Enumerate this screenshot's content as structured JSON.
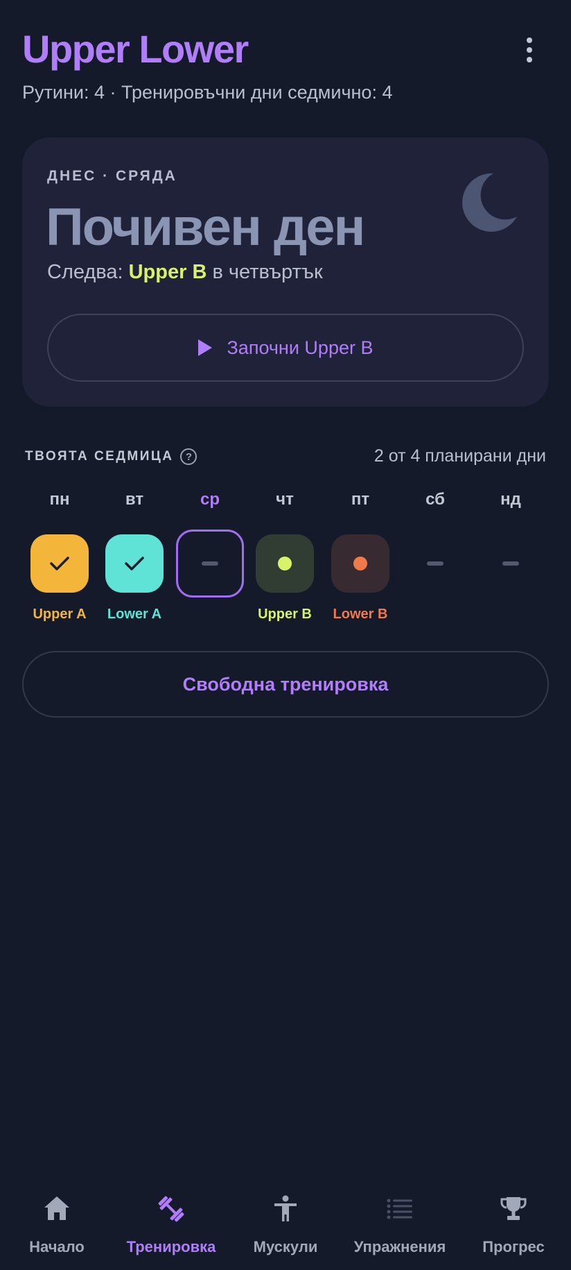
{
  "header": {
    "title": "Upper Lower",
    "subtitle": "Рутини: 4 · Тренировъчни дни седмично: 4",
    "menu_icon": "more-vertical-icon"
  },
  "today": {
    "label": "ДНЕС · СРЯДА",
    "title": "Почивен ден",
    "next_prefix": "Следва: ",
    "next_routine": "Upper B",
    "next_suffix": " в четвъртък",
    "start_button": "Започни Upper B",
    "icon": "moon-icon"
  },
  "week": {
    "label": "ТВОЯТА СЕДМИЦА",
    "help_glyph": "?",
    "summary": "2 от 4 планирани дни",
    "days": [
      {
        "name": "пн",
        "routine": "Upper A",
        "state": "done",
        "color": "#f3b63a"
      },
      {
        "name": "вт",
        "routine": "Lower A",
        "state": "done",
        "color": "#5ee3d6"
      },
      {
        "name": "ср",
        "routine": "",
        "state": "today",
        "color": "#a06ef0"
      },
      {
        "name": "чт",
        "routine": "Upper B",
        "state": "planned",
        "color": "#d8f26a"
      },
      {
        "name": "пт",
        "routine": "Lower B",
        "state": "planned",
        "color": "#f07a4a"
      },
      {
        "name": "сб",
        "routine": "",
        "state": "rest",
        "color": "#545a6e"
      },
      {
        "name": "нд",
        "routine": "",
        "state": "rest",
        "color": "#545a6e"
      }
    ]
  },
  "free_workout_button": "Свободна тренировка",
  "nav": {
    "active": "Тренировка",
    "items": [
      {
        "label": "Начало",
        "icon": "home-icon"
      },
      {
        "label": "Тренировка",
        "icon": "dumbbell-icon"
      },
      {
        "label": "Мускули",
        "icon": "person-icon"
      },
      {
        "label": "Упражнения",
        "icon": "list-icon"
      },
      {
        "label": "Прогрес",
        "icon": "trophy-icon"
      }
    ]
  },
  "colors": {
    "accent": "#b07ef8",
    "background": "#141a29",
    "card": "#1f2239",
    "highlight": "#d8f26a"
  }
}
